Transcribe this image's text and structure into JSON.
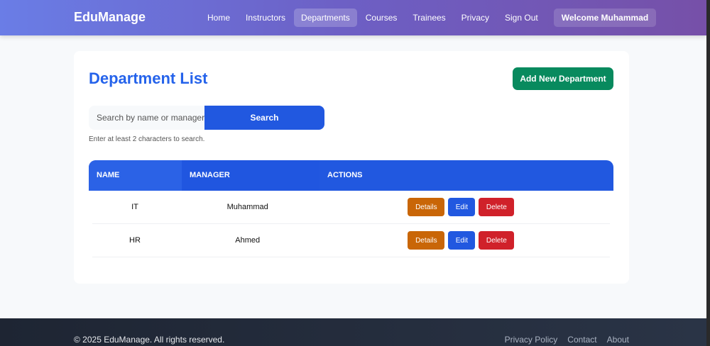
{
  "nav": {
    "brand": "EduManage",
    "links": [
      "Home",
      "Instructors",
      "Departments",
      "Courses",
      "Trainees",
      "Privacy",
      "Sign Out"
    ],
    "active": "Departments",
    "welcome": "Welcome Muhammad"
  },
  "page": {
    "title": "Department List",
    "add_button": "Add New Department",
    "search_placeholder": "Search by name or manager",
    "search_button": "Search",
    "hint": "Enter at least 2 characters to search."
  },
  "table": {
    "headers": [
      "NAME",
      "MANAGER",
      "ACTIONS"
    ],
    "rows": [
      {
        "name": "IT",
        "manager": "Muhammad"
      },
      {
        "name": "HR",
        "manager": "Ahmed"
      }
    ],
    "actions": {
      "details": "Details",
      "edit": "Edit",
      "delete": "Delete"
    }
  },
  "footer": {
    "copyright": "© 2025 EduManage. All rights reserved.",
    "links": [
      "Privacy Policy",
      "Contact",
      "About"
    ]
  }
}
